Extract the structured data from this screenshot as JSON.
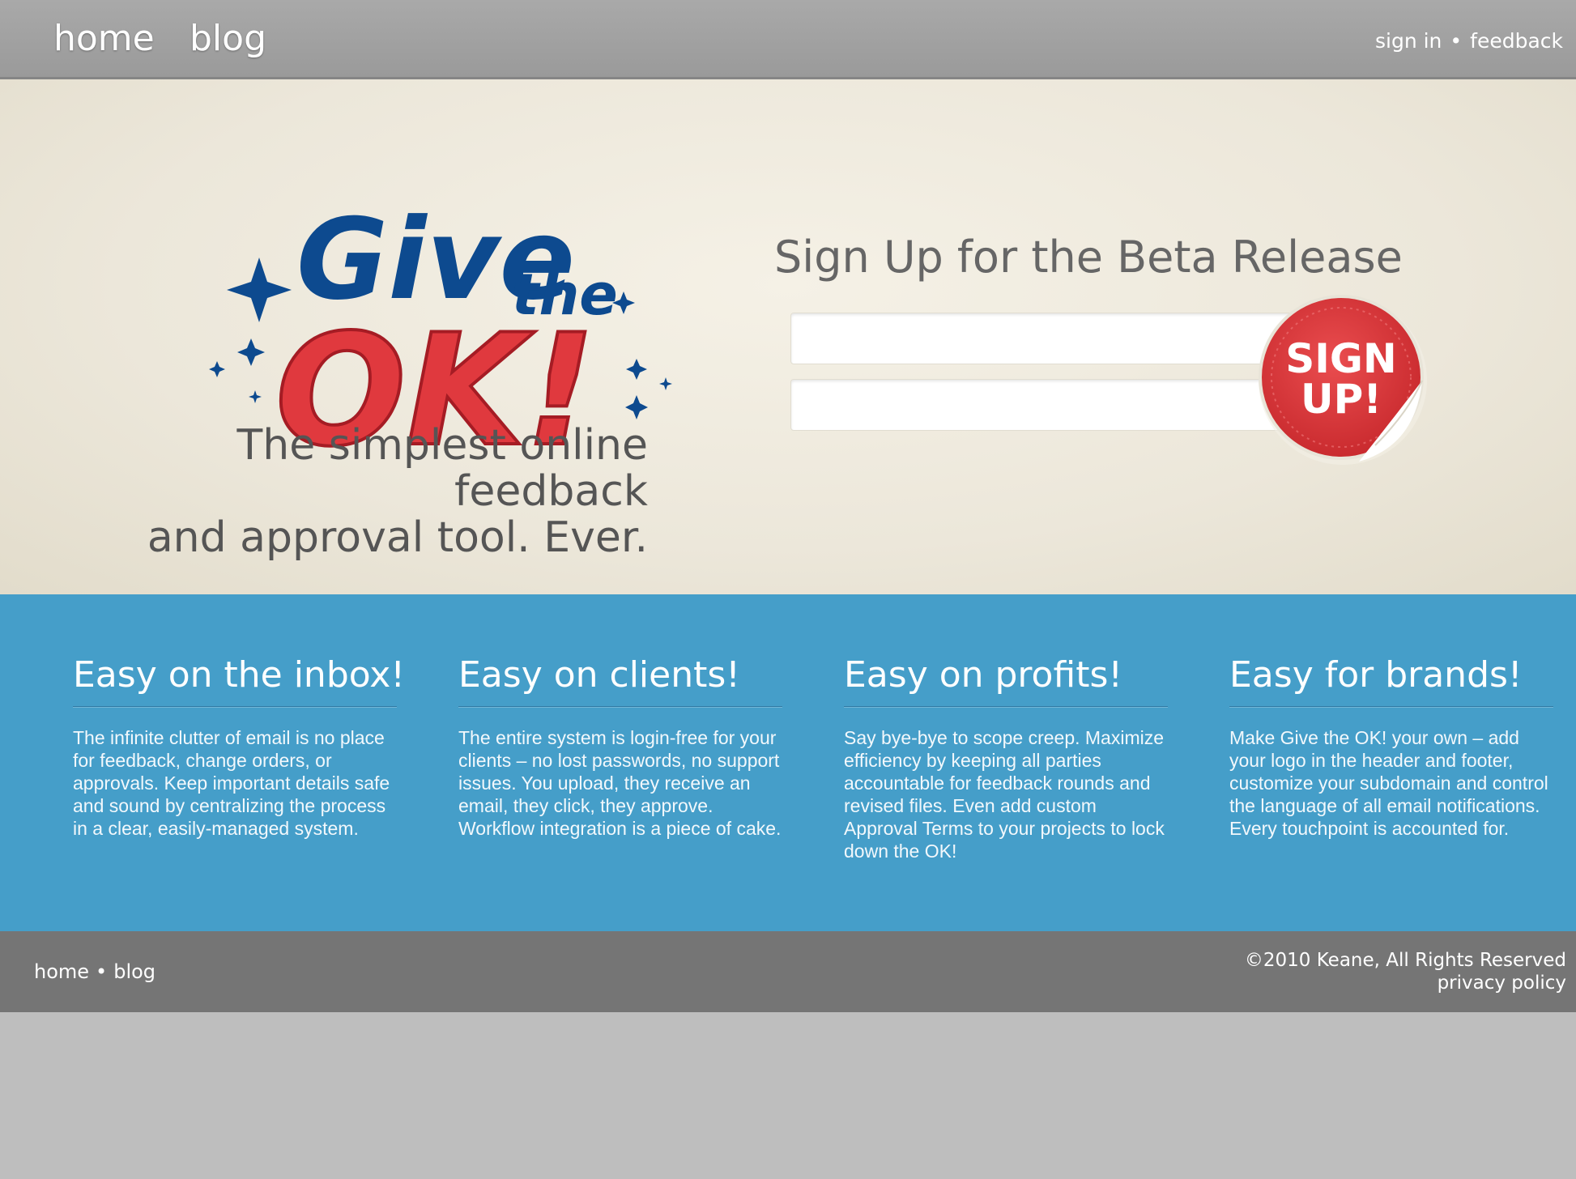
{
  "nav": {
    "home": "home",
    "blog": "blog",
    "sign_in": "sign in",
    "separator": "•",
    "feedback": "feedback"
  },
  "hero": {
    "logo": {
      "line1": "Give",
      "line2": "the",
      "line3": "OK!"
    },
    "tagline_line1": "The simplest online feedback",
    "tagline_line2": "and approval tool. Ever.",
    "signup_title": "Sign Up for the Beta Release",
    "field1_value": "",
    "field2_value": "",
    "signup_button": {
      "line1": "SIGN",
      "line2": "UP!"
    }
  },
  "features": [
    {
      "title": "Easy on the inbox!",
      "body": "The infinite clutter of email is no place for feedback, change orders, or approvals. Keep important details safe and sound by centralizing the process in a clear, easily-managed system."
    },
    {
      "title": "Easy on clients!",
      "body": "The entire system is login-free for your clients – no lost passwords, no support issues. You upload, they receive an email, they click, they approve. Workflow integration is a piece of cake."
    },
    {
      "title": "Easy on profits!",
      "body": "Say bye-bye to scope creep. Maximize efficiency by keeping all parties accountable for feedback rounds and revised files. Even add custom Approval Terms to your projects to lock down the OK!"
    },
    {
      "title": "Easy for brands!",
      "body": "Make Give the OK! your own – add your logo in the header and footer, customize your subdomain and control the language of all email notifications. Every touchpoint is accounted for."
    }
  ],
  "footer": {
    "home": "home",
    "separator": "•",
    "blog": "blog",
    "copyright": "©2010 Keane, All Rights Reserved",
    "privacy": "privacy policy"
  },
  "colors": {
    "logo_blue": "#0d4a8f",
    "logo_red": "#e0393e",
    "band_blue": "#459ec9",
    "footer_gray": "#757575",
    "nav_gray": "#a2a2a2"
  },
  "icons": [
    "sparkle-icon",
    "sticker-peel-icon"
  ]
}
